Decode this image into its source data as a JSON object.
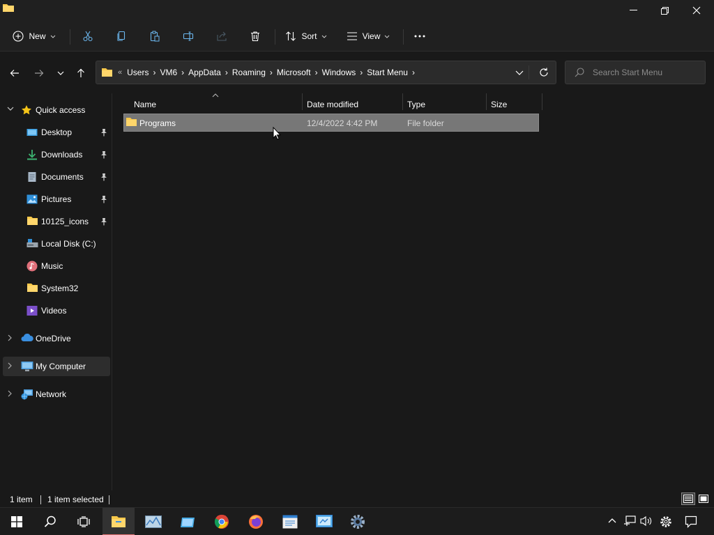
{
  "window": {
    "title_icon": "folder-icon",
    "controls": [
      "minimize-icon",
      "restore-icon",
      "close-icon"
    ]
  },
  "toolbar": {
    "new_label": "New",
    "sort_label": "Sort",
    "view_label": "View",
    "icons": [
      "cut-icon",
      "copy-icon",
      "paste-icon",
      "rename-icon",
      "share-icon",
      "delete-icon",
      "more-icon"
    ]
  },
  "address": {
    "overflow": "«",
    "crumbs": [
      "Users",
      "VM6",
      "AppData",
      "Roaming",
      "Microsoft",
      "Windows",
      "Start Menu"
    ],
    "separator": "›"
  },
  "search": {
    "placeholder": "Search Start Menu"
  },
  "sidebar": {
    "quick_access": "Quick access",
    "items": [
      {
        "label": "Desktop"
      },
      {
        "label": "Downloads"
      },
      {
        "label": "Documents"
      },
      {
        "label": "Pictures"
      },
      {
        "label": "10125_icons"
      },
      {
        "label": "Local Disk (C:)"
      },
      {
        "label": "Music"
      },
      {
        "label": "System32"
      },
      {
        "label": "Videos"
      }
    ],
    "onedrive": "OneDrive",
    "my_computer": "My Computer",
    "network": "Network"
  },
  "columns": {
    "name": "Name",
    "date": "Date modified",
    "type": "Type",
    "size": "Size"
  },
  "files": [
    {
      "name": "Programs",
      "date": "12/4/2022 4:42 PM",
      "type": "File folder",
      "size": ""
    }
  ],
  "status": {
    "count": "1 item",
    "selected": "1 item selected"
  },
  "colors": {
    "accent_folder": "#f8c84a",
    "selection": "#777777",
    "background": "#191919",
    "chrome": "#202020"
  }
}
